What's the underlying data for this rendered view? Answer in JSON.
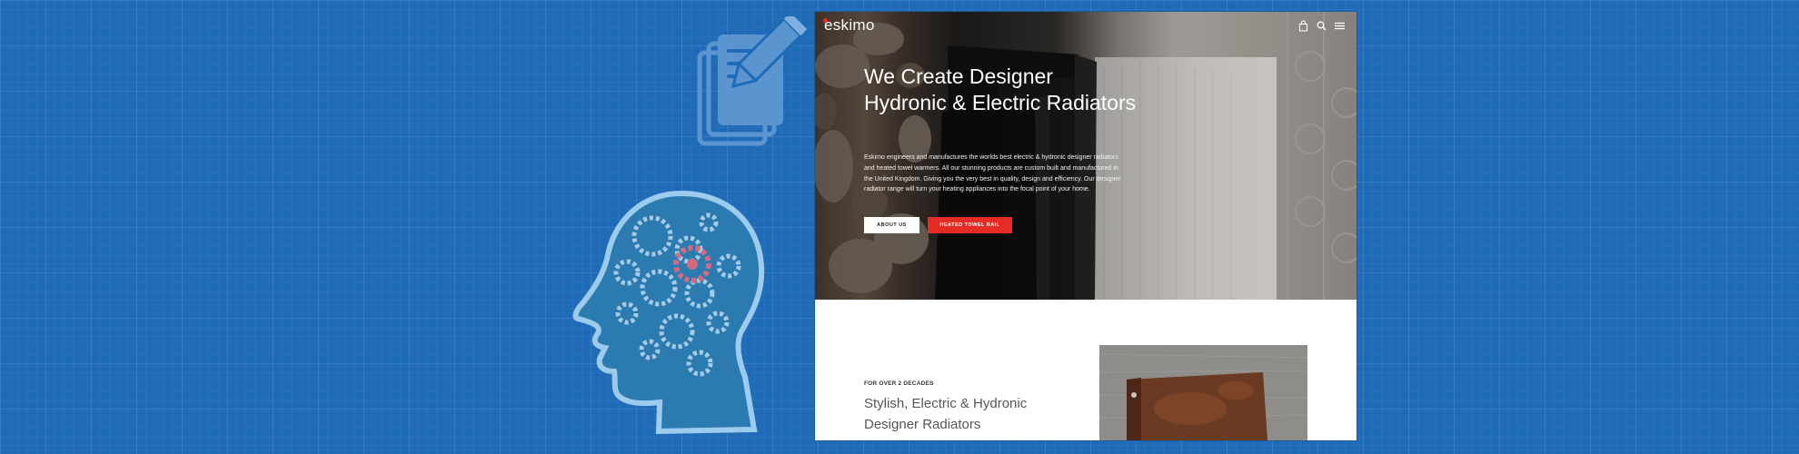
{
  "site": {
    "logo": "eskimo",
    "nav": {
      "cart_count": "0",
      "icons": [
        "bag-icon",
        "search-icon",
        "menu-icon"
      ]
    },
    "hero": {
      "title": "We Create Designer Hydronic & Electric Radiators",
      "body": "Eskimo engineers and manufactures the worlds best electric & hydronic designer radiators and heated towel warmers. All our stunning products are custom built and manufactured in the United Kingdom. Giving you the very best in quality, design and efficiency. Our designer radiator range will turn your heating appliances into the focal point of your home.",
      "buttons": {
        "about": "ABOUT US",
        "towel": "HEATED TOWEL RAIL"
      }
    },
    "section": {
      "kicker": "FOR OVER 2 DECADES",
      "title": "Stylish, Electric & Hydronic Designer Radiators"
    }
  },
  "colors": {
    "background": "#1f6bb8",
    "accent": "#e42b24",
    "illustration": "#4b9fd6"
  }
}
